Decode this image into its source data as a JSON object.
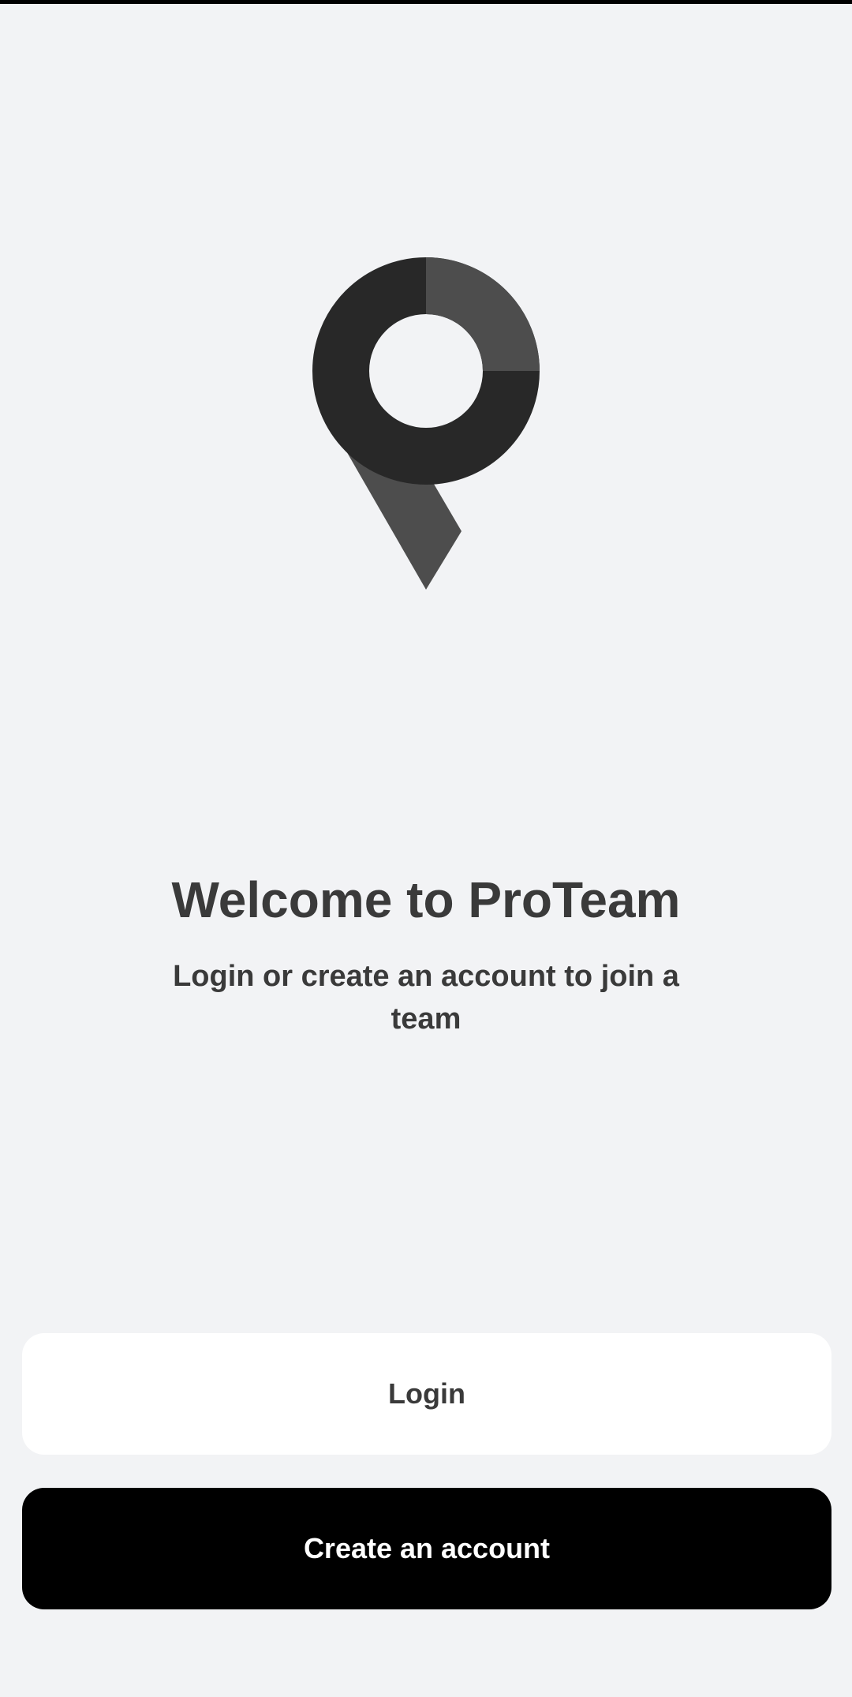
{
  "welcome": {
    "title": "Welcome to ProTeam",
    "subtitle": "Login or create an account to join a team"
  },
  "actions": {
    "login_label": "Login",
    "create_account_label": "Create an account"
  },
  "logo": {
    "icon": "location-pin-logo-icon",
    "colors": {
      "ring": "#282828",
      "accent": "#4d4d4d"
    }
  },
  "theme": {
    "background": "#f2f3f5",
    "text": "#3a3a3a",
    "primary_button": "#000000",
    "secondary_button": "#ffffff"
  }
}
